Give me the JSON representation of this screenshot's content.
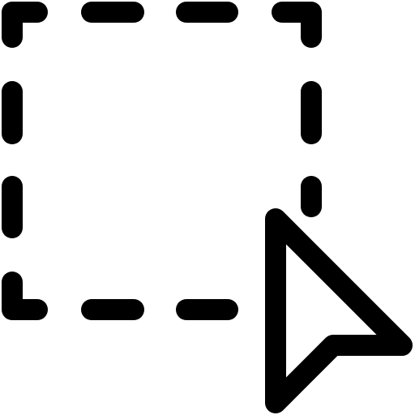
{
  "icon": {
    "name": "select-area-cursor-icon",
    "parts": [
      "dashed-selection-rectangle",
      "mouse-pointer-arrow"
    ],
    "stroke_color": "#000000",
    "background_color": "#ffffff"
  }
}
